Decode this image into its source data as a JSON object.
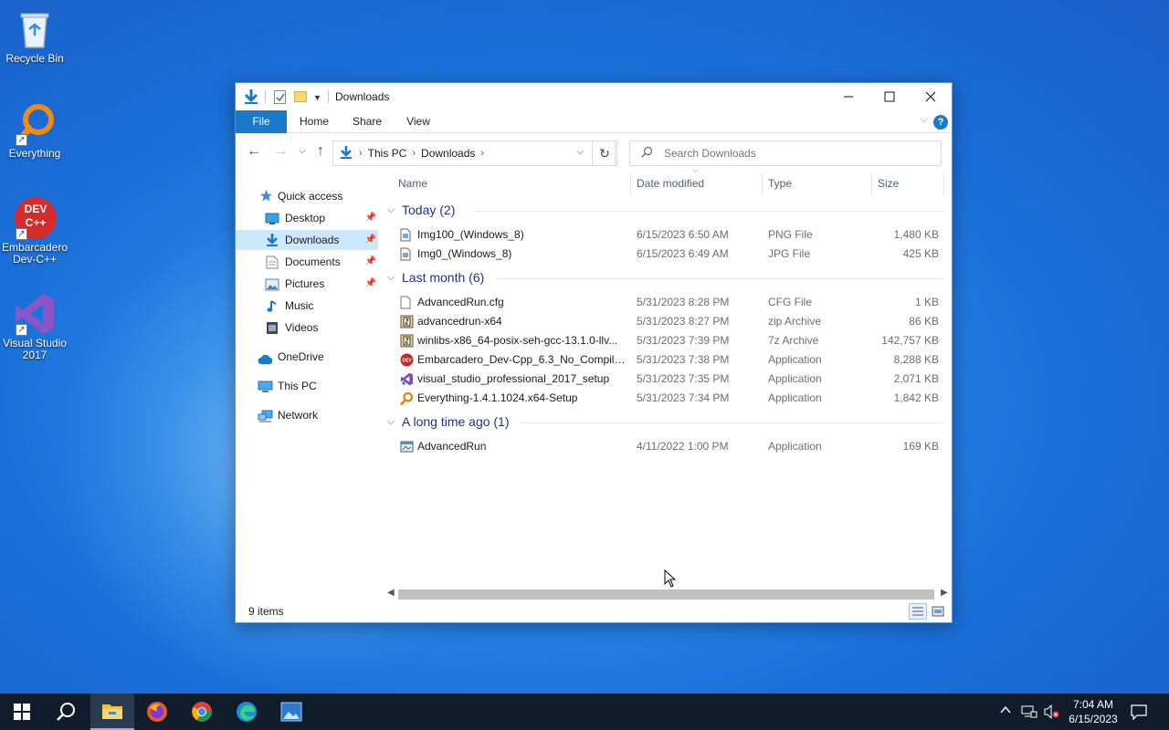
{
  "desktop": {
    "icons": [
      {
        "label": "Recycle Bin"
      },
      {
        "label": "Everything"
      },
      {
        "label": "Embarcadero Dev-C++"
      },
      {
        "label": "Visual Studio 2017"
      }
    ],
    "devcpp_logo_text": "DEV C++"
  },
  "window": {
    "title": "Downloads",
    "ribbon_tabs": [
      "File",
      "Home",
      "Share",
      "View"
    ],
    "help_label": "?",
    "address": {
      "crumbs": [
        "This PC",
        "Downloads"
      ]
    },
    "search_placeholder": "Search Downloads",
    "accent_color": "#1979ca"
  },
  "nav_pane": {
    "items": [
      {
        "label": "Quick access",
        "icon": "star-icon"
      },
      {
        "label": "Desktop",
        "icon": "desktop-icon",
        "pinned": true
      },
      {
        "label": "Downloads",
        "icon": "download-icon",
        "pinned": true,
        "selected": true
      },
      {
        "label": "Documents",
        "icon": "document-icon",
        "pinned": true
      },
      {
        "label": "Pictures",
        "icon": "picture-icon",
        "pinned": true
      },
      {
        "label": "Music",
        "icon": "music-icon"
      },
      {
        "label": "Videos",
        "icon": "video-icon"
      },
      {
        "label": "OneDrive",
        "icon": "cloud-icon"
      },
      {
        "label": "This PC",
        "icon": "computer-icon"
      },
      {
        "label": "Network",
        "icon": "network-icon"
      }
    ]
  },
  "columns": [
    "Name",
    "Date modified",
    "Type",
    "Size"
  ],
  "groups": [
    {
      "label": "Today (2)",
      "files": [
        {
          "name": "Img100_(Windows_8)",
          "date": "6/15/2023 6:50 AM",
          "type": "PNG File",
          "size": "1,480 KB",
          "icon": "image-file-icon"
        },
        {
          "name": "Img0_(Windows_8)",
          "date": "6/15/2023 6:49 AM",
          "type": "JPG File",
          "size": "425 KB",
          "icon": "image-file-icon"
        }
      ]
    },
    {
      "label": "Last month (6)",
      "files": [
        {
          "name": "AdvancedRun.cfg",
          "date": "5/31/2023 8:28 PM",
          "type": "CFG File",
          "size": "1 KB",
          "icon": "blank-file-icon"
        },
        {
          "name": "advancedrun-x64",
          "date": "5/31/2023 8:27 PM",
          "type": "zip Archive",
          "size": "86 KB",
          "icon": "archive-icon"
        },
        {
          "name": "winlibs-x86_64-posix-seh-gcc-13.1.0-llv...",
          "date": "5/31/2023 7:39 PM",
          "type": "7z Archive",
          "size": "142,757 KB",
          "icon": "archive-icon"
        },
        {
          "name": "Embarcadero_Dev-Cpp_6.3_No_Compiler...",
          "date": "5/31/2023 7:38 PM",
          "type": "Application",
          "size": "8,288 KB",
          "icon": "devcpp-icon"
        },
        {
          "name": "visual_studio_professional_2017_setup",
          "date": "5/31/2023 7:35 PM",
          "type": "Application",
          "size": "2,071 KB",
          "icon": "visual-studio-icon"
        },
        {
          "name": "Everything-1.4.1.1024.x64-Setup",
          "date": "5/31/2023 7:34 PM",
          "type": "Application",
          "size": "1,842 KB",
          "icon": "everything-icon"
        }
      ]
    },
    {
      "label": "A long time ago (1)",
      "files": [
        {
          "name": "AdvancedRun",
          "date": "4/11/2022 1:00 PM",
          "type": "Application",
          "size": "169 KB",
          "icon": "app-window-icon"
        }
      ]
    }
  ],
  "status": {
    "item_count": "9 items"
  },
  "taskbar": {
    "clock_time": "7:04 AM",
    "clock_date": "6/15/2023"
  }
}
